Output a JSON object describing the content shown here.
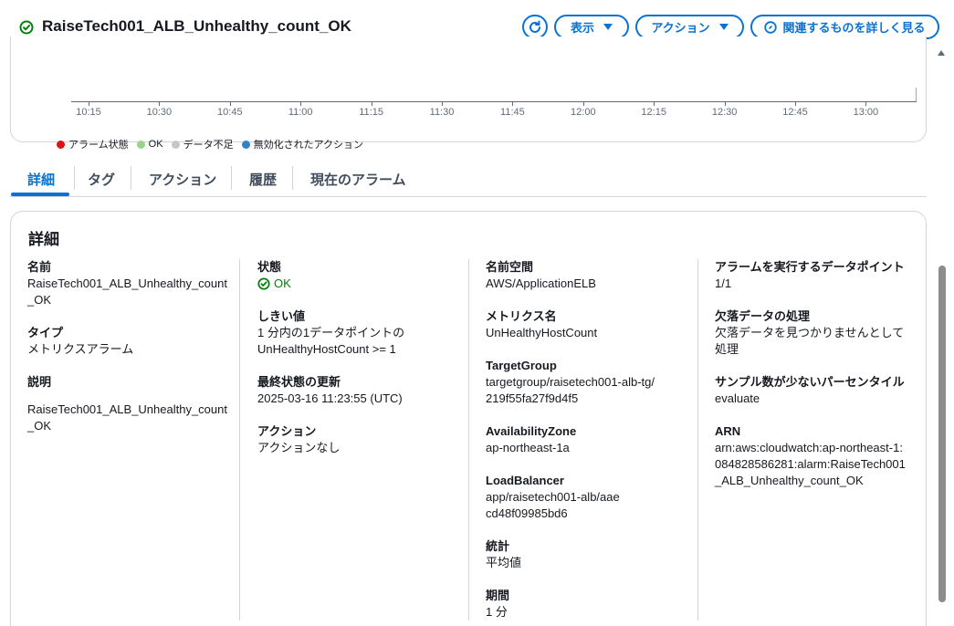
{
  "header": {
    "alarm_name": "RaiseTech001_ALB_Unhealthy_count_OK",
    "status_icon": "check-circle-icon",
    "refresh_icon": "refresh-icon",
    "view_label": "表示",
    "actions_label": "アクション",
    "related_label": "関連するものを詳しく見る",
    "related_icon": "compass-icon",
    "accent_color": "#0972d3",
    "ok_color": "#037f0c"
  },
  "chart": {
    "time_ticks": [
      "10:15",
      "10:30",
      "10:45",
      "11:00",
      "11:15",
      "11:30",
      "11:45",
      "12:00",
      "12:15",
      "12:30",
      "12:45",
      "13:00"
    ],
    "legend": [
      {
        "label": "アラーム状態",
        "color": "#d91515"
      },
      {
        "label": "OK",
        "color": "#9ad38a"
      },
      {
        "label": "データ不足",
        "color": "#c6c6cd"
      },
      {
        "label": "無効化されたアクション",
        "color": "#2e84c6"
      }
    ]
  },
  "tabs": [
    {
      "label": "詳細",
      "active": true
    },
    {
      "label": "タグ",
      "active": false
    },
    {
      "label": "アクション",
      "active": false
    },
    {
      "label": "履歴",
      "active": false
    },
    {
      "label": "現在のアラーム",
      "active": false
    }
  ],
  "details": {
    "heading": "詳細",
    "col1": {
      "name_label": "名前",
      "name_value": "RaiseTech001_ALB_Unhealthy_count_OK",
      "type_label": "タイプ",
      "type_value": "メトリクスアラーム",
      "desc_label": "説明",
      "desc_value": "RaiseTech001_ALB_Unhealthy_count_OK"
    },
    "col2": {
      "state_label": "状態",
      "state_value": "OK",
      "threshold_label": "しきい値",
      "threshold_value": "1 分内の1データポイントの UnHealthyHostCount >= 1",
      "last_update_label": "最終状態の更新",
      "last_update_value": "2025-03-16 11:23:55 (UTC)",
      "action_label": "アクション",
      "action_value": "アクションなし"
    },
    "col3": {
      "namespace_label": "名前空間",
      "namespace_value": "AWS/ApplicationELB",
      "metric_label": "メトリクス名",
      "metric_value": "UnHealthyHostCount",
      "tg_label": "TargetGroup",
      "tg_value": "targetgroup/raisetech001-alb-tg/219f55fa27f9d4f5",
      "az_label": "AvailabilityZone",
      "az_value": "ap-northeast-1a",
      "lb_label": "LoadBalancer",
      "lb_value": "app/raisetech001-alb/aaecd48f09985bd6",
      "stat_label": "統計",
      "stat_value": "平均値",
      "period_label": "期間",
      "period_value": "1 分"
    },
    "col4": {
      "datapoints_label": "アラームを実行するデータポイント",
      "datapoints_value": "1/1",
      "missing_label": "欠落データの処理",
      "missing_value": "欠落データを見つかりませんとして処理",
      "percentile_label": "サンプル数が少ないパーセンタイル",
      "percentile_value": "evaluate",
      "arn_label": "ARN",
      "arn_value": "arn:aws:cloudwatch:ap-northeast-1:084828586281:alarm:RaiseTech001_ALB_Unhealthy_count_OK"
    }
  }
}
